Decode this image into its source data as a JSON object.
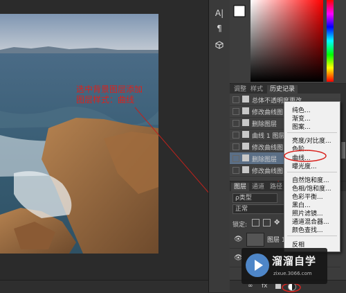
{
  "canvas": {
    "annotation_line1": "选中背景图层添加",
    "annotation_line2": "图层样式：曲线"
  },
  "tools": {
    "type_icon": "A|",
    "paragraph_icon": "¶",
    "cube_icon": "cube-icon"
  },
  "history_panel": {
    "tabs": [
      "调整",
      "样式",
      "历史记录"
    ],
    "active_tab": "历史记录",
    "items": [
      "总体不透明度更改",
      "修改曲线图",
      "删除图层",
      "曲线 1 图层",
      "修改曲线图",
      "删除图层",
      "修改曲线图"
    ],
    "selected_index": 5
  },
  "layers_panel": {
    "tabs": [
      "图层",
      "通道",
      "路径"
    ],
    "active_tab": "图层",
    "filter_label": "ρ类型",
    "blend_mode": "正常",
    "lock_label": "锁定:",
    "layer_name": "图层 1",
    "bottom_icons": [
      "link-icon",
      "fx-icon",
      "mask-icon",
      "adjustment-icon"
    ],
    "fx_label": "fx"
  },
  "adjust_menu": {
    "groups": [
      [
        "纯色...",
        "渐变...",
        "图案..."
      ],
      [
        "亮度/对比度...",
        "色阶...",
        "曲线...",
        "曝光度..."
      ],
      [
        "自然饱和度...",
        "色相/饱和度...",
        "色彩平衡...",
        "黑白...",
        "照片滤镜...",
        "通道混合器...",
        "颜色查找..."
      ],
      [
        "反相"
      ]
    ],
    "highlighted": "曲线..."
  },
  "watermark": {
    "title": "溜溜自学",
    "url": "zixue.3066.com"
  },
  "colors": {
    "annotation": "#d9231e",
    "selection": "#5b6f86",
    "menu_bg": "#f0f0f0"
  }
}
